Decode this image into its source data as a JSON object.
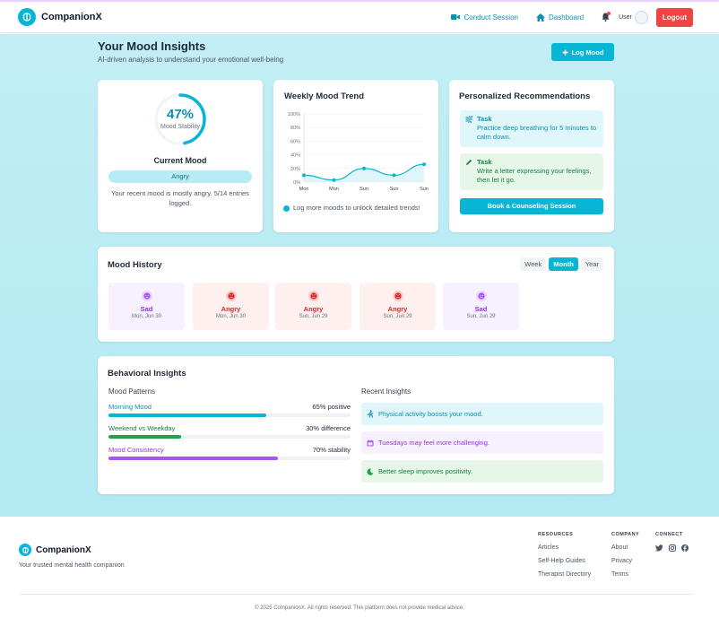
{
  "brand": {
    "name": "CompanionX",
    "accent": "#06b6d4"
  },
  "nav": {
    "conduct_session": "Conduct Session",
    "dashboard": "Dashboard",
    "user_label": "User",
    "logout": "Logout"
  },
  "header": {
    "title": "Your Mood Insights",
    "subtitle": "AI-driven analysis to understand your emotional well-being",
    "log_mood": "Log Mood"
  },
  "current_mood": {
    "percent": "47%",
    "percent_value": 47,
    "ring_label": "Mood Stability",
    "title": "Current Mood",
    "mood": "Angry",
    "description": "Your recent mood is mostly angry. 5/14 entries logged."
  },
  "trend": {
    "title": "Weekly Mood Trend",
    "note": "Log more moods to unlock detailed trends!",
    "chart_data": {
      "type": "area",
      "title": "Weekly Mood Trend",
      "categories": [
        "Mon",
        "Mon",
        "Sun",
        "Sun",
        "Sun"
      ],
      "series": [
        {
          "values": [
            10,
            3,
            20,
            10,
            26
          ]
        }
      ],
      "ylim": [
        0,
        100
      ],
      "yticks": [
        "100%",
        "80%",
        "60%",
        "40%",
        "20%",
        "0%"
      ],
      "grid": true,
      "color": "#06b6d4"
    }
  },
  "recommendations": {
    "title": "Personalized Recommendations",
    "items": [
      {
        "head": "Task",
        "body": "Practice deep breathing for 5 minutes to calm down.",
        "icon": "wind-icon",
        "style": "blue"
      },
      {
        "head": "Task",
        "body": "Write a letter expressing your feelings, then let it go.",
        "icon": "pen-icon",
        "style": "green"
      }
    ],
    "book": "Book a Counseling Session"
  },
  "history": {
    "title": "Mood History",
    "ranges": [
      "Week",
      "Month",
      "Year"
    ],
    "active_range": "Month",
    "entries": [
      {
        "mood": "Sad",
        "date": "Mon, Jun 30"
      },
      {
        "mood": "Angry",
        "date": "Mon, Jun 30"
      },
      {
        "mood": "Angry",
        "date": "Sun, Jun 29"
      },
      {
        "mood": "Angry",
        "date": "Sun, Jun 29"
      },
      {
        "mood": "Sad",
        "date": "Sun, Jun 29"
      }
    ]
  },
  "behavioral": {
    "title": "Behavioral Insights",
    "patterns_title": "Mood Patterns",
    "patterns": [
      {
        "label": "Morning Mood",
        "value": "65% positive",
        "fill": 0.65,
        "color": "#06b6d4"
      },
      {
        "label": "Weekend vs Weekday",
        "value": "30% difference",
        "fill": 0.3,
        "color": "#22a34a"
      },
      {
        "label": "Mood Consistency",
        "value": "70% stability",
        "fill": 0.7,
        "color": "#a855f7"
      }
    ],
    "recent_title": "Recent Insights",
    "recent": [
      {
        "text": "Physical activity boosts your mood.",
        "icon": "running-icon"
      },
      {
        "text": "Tuesdays may feel more challenging.",
        "icon": "calendar-icon"
      },
      {
        "text": "Better sleep improves positivity.",
        "icon": "moon-icon"
      }
    ]
  },
  "footer": {
    "name": "CompanionX",
    "tagline": "Your trusted mental health companion",
    "resources_head": "RESOURCES",
    "resources": [
      "Articles",
      "Self-Help Guides",
      "Therapist Directory"
    ],
    "company_head": "COMPANY",
    "company": [
      "About",
      "Privacy",
      "Terms"
    ],
    "connect_head": "CONNECT",
    "copyright": "© 2025 CompanionX. All rights reserved. This platform does not provide medical advice."
  }
}
